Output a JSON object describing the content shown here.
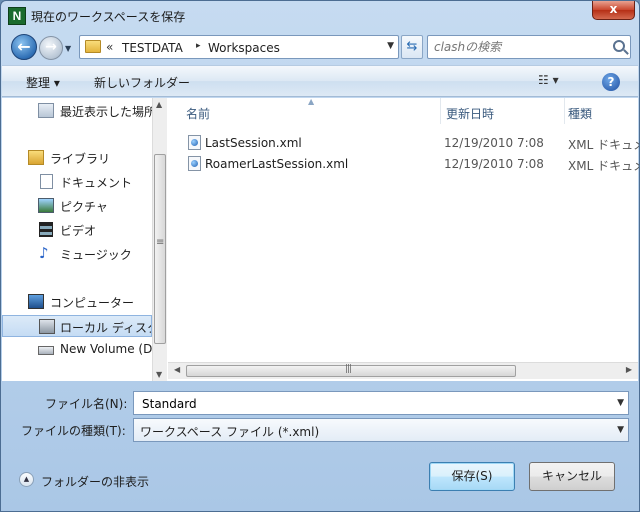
{
  "window": {
    "title": "現在のワークスペースを保存",
    "close_glyph": "x",
    "app_icon_letter": "N"
  },
  "address": {
    "overflow": "«",
    "segments": [
      "TESTDATA",
      "Workspaces"
    ],
    "separator": "▸"
  },
  "search": {
    "placeholder": "clashの検索"
  },
  "toolbar": {
    "organize_label": "整理 ▾",
    "new_folder_label": "新しいフォルダー",
    "views_label": "☷ ▾",
    "help_label": "?"
  },
  "nav": {
    "recent": "最近表示した場所",
    "libraries": "ライブラリ",
    "documents": "ドキュメント",
    "pictures": "ピクチャ",
    "videos": "ビデオ",
    "music": "ミュージック",
    "computer": "コンピューター",
    "local_disk": "ローカル ディスク (C:)",
    "new_volume": "New Volume (D:)"
  },
  "columns": {
    "name": "名前",
    "date": "更新日時",
    "type": "種類"
  },
  "files": [
    {
      "name": "LastSession.xml",
      "date": "12/19/2010 7:08",
      "type": "XML ドキュメント"
    },
    {
      "name": "RoamerLastSession.xml",
      "date": "12/19/2010 7:08",
      "type": "XML ドキュメント"
    }
  ],
  "form": {
    "filename_label": "ファイル名(N):",
    "filename_value": "Standard",
    "filetype_label": "ファイルの種類(T):",
    "filetype_value": "ワークスペース ファイル (*.xml)"
  },
  "footer": {
    "hide_folders": "フォルダーの非表示",
    "save_label": "保存(S)",
    "cancel_label": "キャンセル"
  }
}
